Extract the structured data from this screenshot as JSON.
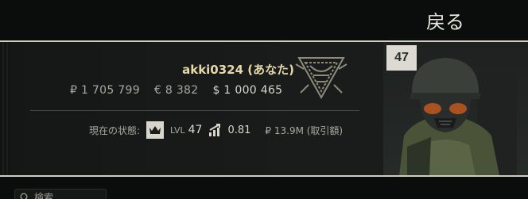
{
  "header": {
    "back_label": "戻る"
  },
  "profile": {
    "nickname": "akki0324 (あなた)",
    "level": "47",
    "currencies": {
      "rub": "₽ 1 705 799",
      "eur": "€ 8 382",
      "usd": "$ 1 000 465"
    },
    "status": {
      "label": "現在の状態:",
      "lvl_label": "LVL",
      "lvl_value": "47",
      "kd_value": "0.81",
      "trade_volume": "₽ 13.9M (取引額)"
    }
  },
  "search": {
    "placeholder": "検索"
  },
  "colors": {
    "accent": "#e6d9a8",
    "frame": "#cfcdc3",
    "badge": "#dcdad2"
  }
}
